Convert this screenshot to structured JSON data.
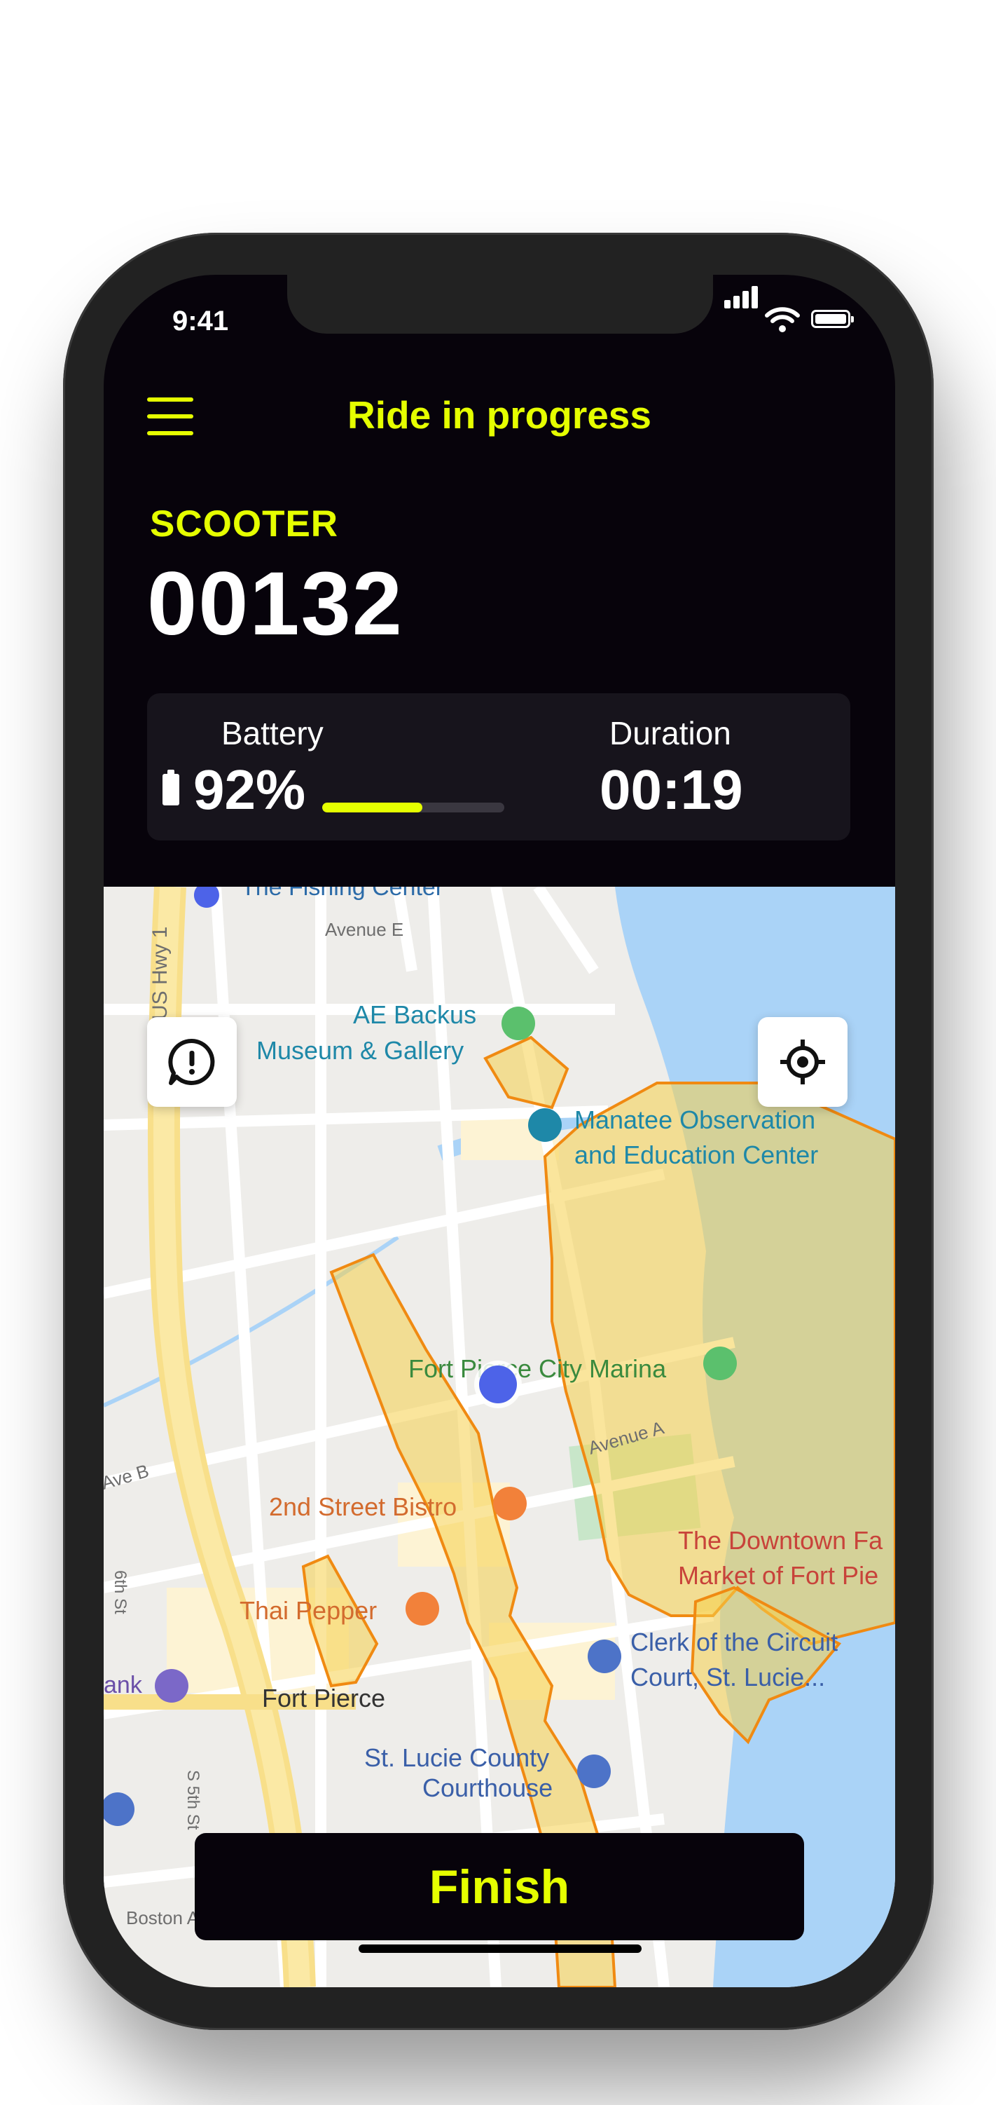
{
  "status_bar": {
    "time": "9:41"
  },
  "header": {
    "title": "Ride in progress"
  },
  "vehicle": {
    "type_label": "SCOOTER",
    "number": "00132"
  },
  "stats": {
    "battery_label": "Battery",
    "battery_value": "92%",
    "battery_bar_fraction": 0.55,
    "duration_label": "Duration",
    "duration_value": "00:19"
  },
  "map": {
    "labels": {
      "fishing_center": "The Fishing Center",
      "avenue_e": "Avenue E",
      "us_hwy": "US Hwy 1",
      "ae_backus_1": "AE Backus",
      "ae_backus_2": "Museum & Gallery",
      "manatee_1": "Manatee Observation",
      "manatee_2": "and Education Center",
      "marina": "Fort Pierce City Marina",
      "avenue_a": "Avenue A",
      "ave_b": "Ave B",
      "second_street": "2nd Street Bistro",
      "downtown_1": "The Downtown Fa",
      "downtown_2": "Market of Fort Pie",
      "thai_pepper": "Thai Pepper",
      "clerk_1": "Clerk of the Circuit",
      "clerk_2": "Court, St. Lucie...",
      "bank": "ank",
      "fort_pierce": "Fort Pierce",
      "st_lucie_1": "St. Lucie County",
      "st_lucie_2": "Courthouse",
      "sixth_st": "6th St",
      "fifth_st": "S 5th St",
      "boston_ave": "Boston Ave"
    },
    "colors": {
      "zone_fill": "#f5cf4a",
      "zone_stroke": "#f08a12",
      "water": "#aad3f7",
      "user_dot": "#4d63e8"
    }
  },
  "actions": {
    "finish_label": "Finish",
    "report_icon": "alert-bubble-icon",
    "locate_icon": "crosshair-icon"
  },
  "theme": {
    "accent": "#e5ff00",
    "background": "#07030b"
  }
}
